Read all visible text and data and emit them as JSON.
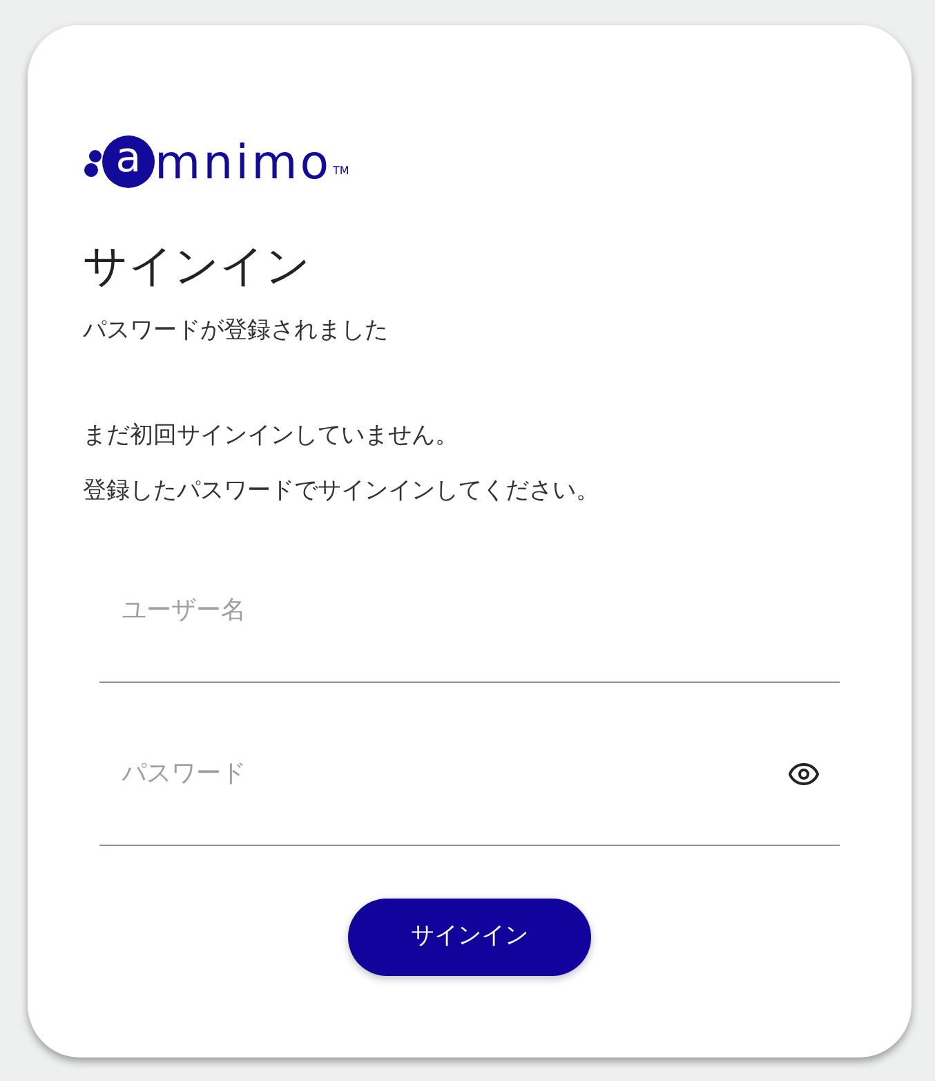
{
  "logo": {
    "initial": "a",
    "rest": "mnimo",
    "mark": "TM"
  },
  "title": "サインイン",
  "notice": "パスワードが登録されました",
  "message": [
    "まだ初回サインインしていません。",
    "登録したパスワードでサインインしてください。"
  ],
  "fields": [
    {
      "kind": "text",
      "placeholder": "ユーザー名"
    },
    {
      "kind": "password",
      "placeholder": "パスワード"
    }
  ],
  "submit": "サインイン"
}
